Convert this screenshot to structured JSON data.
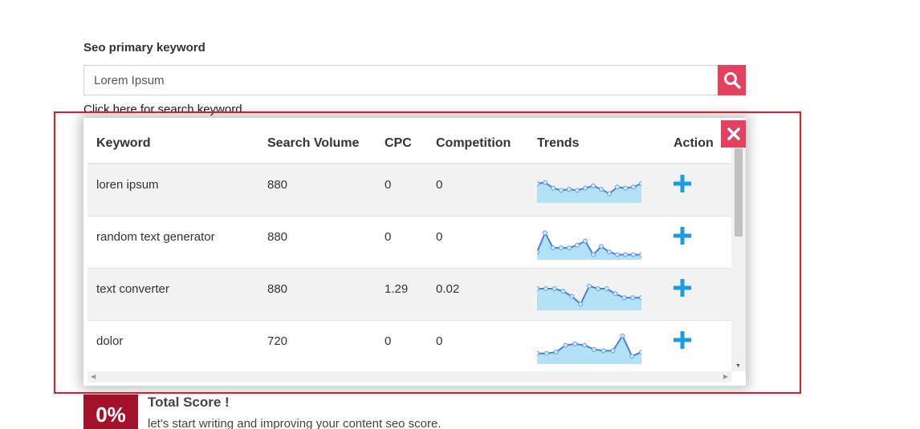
{
  "keyword_section": {
    "label": "Seo primary keyword",
    "input_value": "Lorem Ipsum",
    "click_hint": "Click here for search keyword"
  },
  "table": {
    "headers": [
      "Keyword",
      "Search Volume",
      "CPC",
      "Competition",
      "Trends",
      "Action"
    ],
    "rows": [
      {
        "keyword": "loren ipsum",
        "volume": "880",
        "cpc": "0",
        "competition": "0",
        "trend": [
          0.75,
          0.8,
          0.55,
          0.45,
          0.5,
          0.45,
          0.55,
          0.65,
          0.5,
          0.3,
          0.6,
          0.55,
          0.6,
          0.75
        ]
      },
      {
        "keyword": "random text generator",
        "volume": "880",
        "cpc": "0",
        "competition": "0",
        "trend": [
          0.2,
          0.9,
          0.35,
          0.35,
          0.35,
          0.45,
          0.6,
          0.1,
          0.4,
          0.2,
          0.1,
          0.1,
          0.1,
          0.1
        ]
      },
      {
        "keyword": "text converter",
        "volume": "880",
        "cpc": "1.29",
        "competition": "0.02",
        "trend": [
          0.75,
          0.75,
          0.75,
          0.65,
          0.45,
          0.15,
          0.85,
          0.75,
          0.75,
          0.55,
          0.4,
          0.4,
          0.4
        ]
      },
      {
        "keyword": "dolor",
        "volume": "720",
        "cpc": "0",
        "competition": "0",
        "trend": [
          0.3,
          0.3,
          0.35,
          0.6,
          0.65,
          0.6,
          0.45,
          0.4,
          0.4,
          0.95,
          0.2,
          0.35
        ]
      }
    ]
  },
  "score": {
    "value": "0%",
    "title": "Total Score !",
    "subtitle": "let's start writing and improving your content seo score."
  },
  "colors": {
    "accent": "#e4405f",
    "plus": "#1a9de0",
    "trend_fill": "#b3e2f7",
    "trend_line": "#4a7fe0",
    "score_bg": "#a3122a",
    "highlight": "#e31b23"
  },
  "icons": {
    "search": "magnifier-icon",
    "close": "close-icon",
    "add": "plus-icon"
  }
}
